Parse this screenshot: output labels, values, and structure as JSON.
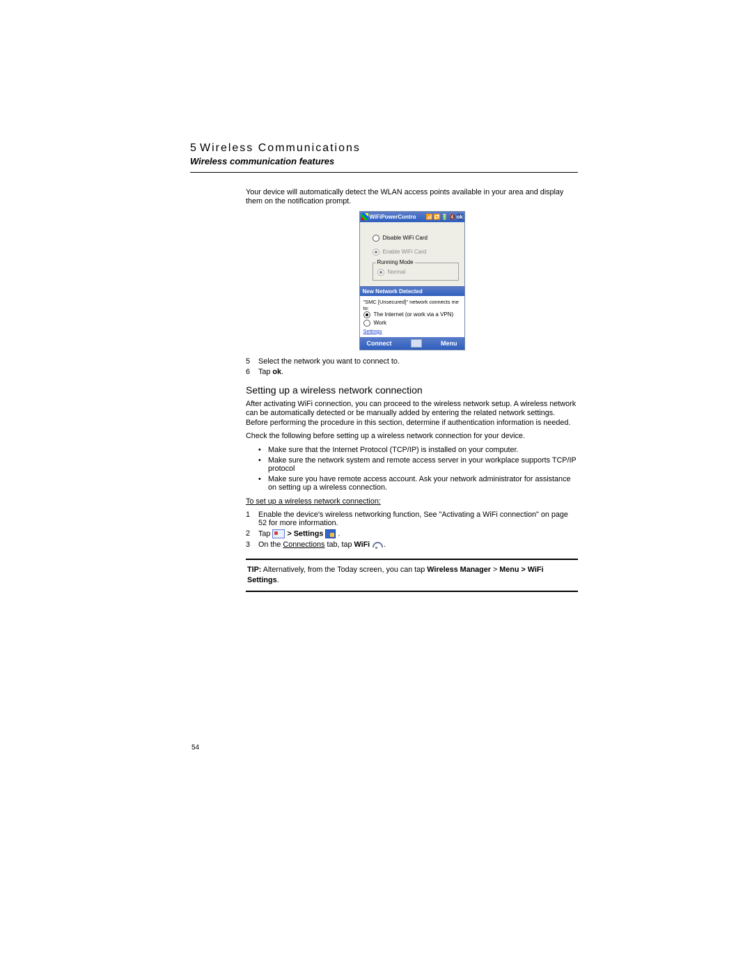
{
  "header": {
    "chapter_number": "5",
    "chapter_title": "Wireless Communications",
    "subtitle": "Wireless communication features"
  },
  "intro_para": "Your device will automatically detect the WLAN access points available in your area and display them on the notification prompt.",
  "wifi_screenshot": {
    "title": "WiFiPowerContro",
    "option_disable": "Disable WiFi Card",
    "option_enable": "Enable WiFi Card",
    "group_label": "Running Mode",
    "group_option": "Normal",
    "notif_title": "New Network Detected",
    "notif_msg": "\"SMC [Unsecured]\" network connects me to:",
    "notif_opt1": "The Internet (or work via a VPN)",
    "notif_opt2": "Work",
    "settings_link": "Settings",
    "soft_left": "Connect",
    "soft_right": "Menu"
  },
  "steps_a": {
    "n5": "5",
    "t5": "Select the network you want to connect to.",
    "n6": "6",
    "t6_prefix": "Tap ",
    "t6_bold": "ok",
    "t6_suffix": "."
  },
  "section_heading": "Setting up a wireless network connection",
  "section_para": "After activating WiFi connection, you can proceed to the wireless network setup. A wireless network can be automatically detected or be manually added by entering the related network settings. Before performing the procedure in this section, determine if authentication information is needed.",
  "check_line": "Check the following before setting up a wireless network connection for your device.",
  "bullets": {
    "b1": "Make sure that the Internet Protocol (TCP/IP) is installed on your computer.",
    "b2": "Make sure the network system and remote access server in your workplace supports TCP/IP protocol",
    "b3": "Make sure you have remote access account. Ask your network administrator for assistance on setting up a wireless connection."
  },
  "setup_heading": "To set up a wireless network connection:",
  "steps_b": {
    "n1": "1",
    "t1": "Enable the device's wireless networking function, See \"Activating a WiFi connection\" on page 52 for more information.",
    "n2": "2",
    "t2_prefix": "Tap ",
    "t2_gt": " > ",
    "t2_settings": "Settings",
    "t2_suffix": " .",
    "n3": "3",
    "t3_prefix": "On the ",
    "t3_underline": "Connections",
    "t3_mid": " tab, tap ",
    "t3_wifi": "WiFi",
    "t3_suffix": " ."
  },
  "tip": {
    "label": "TIP:",
    "body_prefix": "   Alternatively, from the Today screen, you can tap ",
    "bold1": "Wireless Manager",
    "gt1": " > ",
    "bold2": "Menu > WiFi Settings",
    "suffix": "."
  },
  "page_number": "54"
}
